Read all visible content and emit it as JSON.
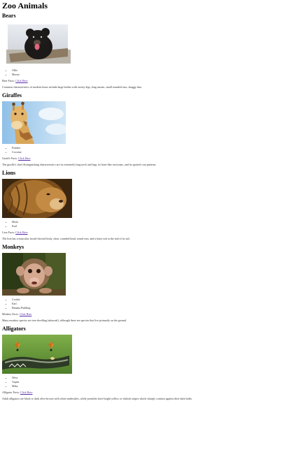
{
  "page": {
    "title": "Zoo Animals"
  },
  "link_label": "Click Here",
  "animals": [
    {
      "name": "Bears",
      "image_alt": "bear",
      "names": [
        "Ollie",
        "Moose"
      ],
      "facts_label": "Bear Facts:",
      "description": "Common characteristics of modern bears include large bodies with stocky legs, long snouts, small rounded ears, shaggy hair."
    },
    {
      "name": "Giraffes",
      "image_alt": "giraffe",
      "names": [
        "Frankie",
        "Coconut"
      ],
      "facts_label": "Giraffe Facts:",
      "description": "The giraffe's chief distinguishing characteristics are its extremely long neck and legs, its horn-like ossicones, and its spotted coat patterns."
    },
    {
      "name": "Lions",
      "image_alt": "lion",
      "names": [
        "Mufu",
        "Karl"
      ],
      "facts_label": "Lion Facts:",
      "description": "The lion has a muscular, broad-chested body, short, rounded head, round ears, and a hairy tuft at the end of its tail."
    },
    {
      "name": "Monkeys",
      "image_alt": "monkey",
      "names": [
        "Cookie",
        "Earl",
        "Banana Pudding"
      ],
      "facts_label": "Monkey Facts:",
      "description": "Many monkey species are tree-dwelling (arboreal), although there are species that live primarily on the ground."
    },
    {
      "name": "Alligators",
      "image_alt": "alligator",
      "names": [
        "Wess",
        "Aspen",
        "Mika"
      ],
      "facts_label": "Alligator Facts:",
      "description": "Adult alligators are black or dark olive-brown with white undersides, while juveniles have bright yellow or whitish stripes which sharply contrast against their dark hides."
    }
  ]
}
